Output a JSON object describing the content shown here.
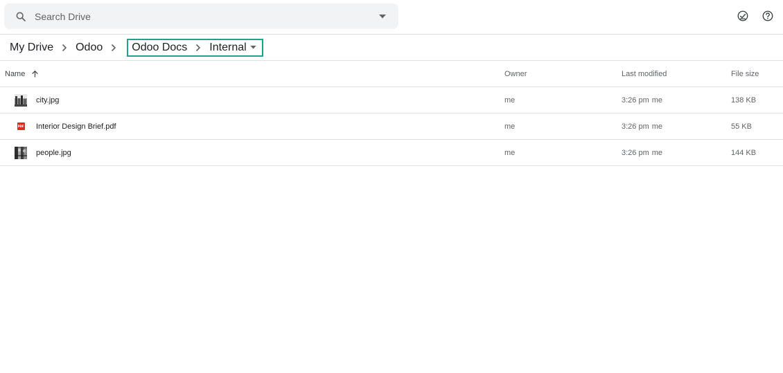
{
  "search": {
    "placeholder": "Search Drive"
  },
  "icons": {
    "search": "search-icon",
    "search_options": "caret-down-icon",
    "ready_offline": "check-circle-icon",
    "help": "help-icon",
    "breadcrumb_separator": "chevron-right-icon",
    "folder_menu": "caret-down-icon",
    "sort": "arrow-up-icon",
    "image_file": "image-thumbnail-icon",
    "pdf_file": "pdf-icon"
  },
  "breadcrumb": {
    "items": [
      "My Drive",
      "Odoo",
      "Odoo Docs",
      "Internal"
    ],
    "highlight_color": "#21a08d"
  },
  "table": {
    "columns": {
      "name": "Name",
      "owner": "Owner",
      "last_modified": "Last modified",
      "file_size": "File size"
    },
    "sort": "ascending",
    "rows": [
      {
        "name": "city.jpg",
        "type": "image",
        "owner": "me",
        "modified_time": "3:26 pm",
        "modified_by": "me",
        "size": "138 KB"
      },
      {
        "name": "Interior Design Brief.pdf",
        "type": "pdf",
        "pdf_label": "PDF",
        "owner": "me",
        "modified_time": "3:26 pm",
        "modified_by": "me",
        "size": "55 KB"
      },
      {
        "name": "people.jpg",
        "type": "image",
        "owner": "me",
        "modified_time": "3:26 pm",
        "modified_by": "me",
        "size": "144 KB"
      }
    ]
  },
  "colors": {
    "search_bg": "#f1f3f4",
    "divider": "#e0e0e0",
    "pdf_red": "#d93025",
    "secondary_text": "#5f6368"
  }
}
